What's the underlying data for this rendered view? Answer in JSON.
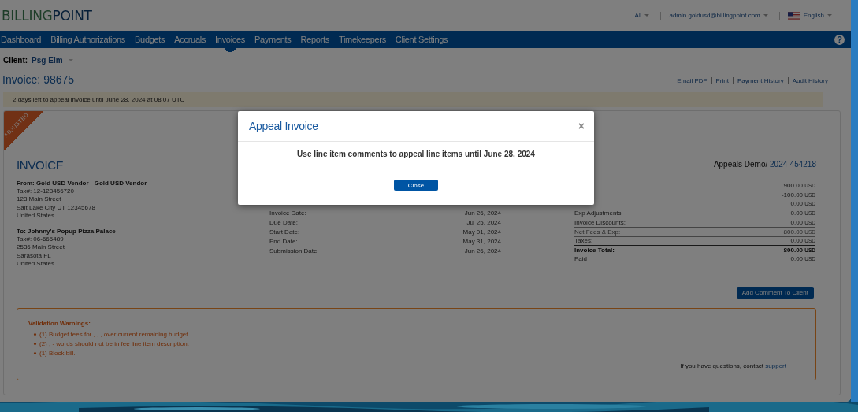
{
  "header": {
    "logo": [
      "BILLING",
      "POINT"
    ],
    "scope": "All",
    "user": "admin.goldusd@billingpoint.com",
    "language": "English"
  },
  "nav": [
    {
      "label": "Dashboard",
      "selected": false
    },
    {
      "label": "Billing Authorizations",
      "selected": false
    },
    {
      "label": "Budgets",
      "selected": false
    },
    {
      "label": "Accruals",
      "selected": false
    },
    {
      "label": "Invoices",
      "selected": true
    },
    {
      "label": "Payments",
      "selected": false
    },
    {
      "label": "Reports",
      "selected": false
    },
    {
      "label": "Timekeepers",
      "selected": false
    },
    {
      "label": "Client Settings",
      "selected": false
    }
  ],
  "help": "?",
  "client": {
    "label": "Client:",
    "name": "Psg Elm"
  },
  "invoice_title": "Invoice: 98675",
  "actions": [
    "Email PDF",
    "Print",
    "Payment History",
    "Audit History"
  ],
  "alert": "2 days left to appeal invoice until June 28, 2024 at 08:07 UTC",
  "invoice": {
    "ribbon": "ADJUSTED",
    "heading": "INVOICE",
    "project": {
      "label": "Appeals Demo/",
      "link": "2024-454218"
    },
    "from": {
      "title": "From: Gold USD Vendor - Gold USD Vendor",
      "lines": [
        "Tax#: 12-123456720",
        "123 Main Street",
        "Salt Lake City UT 12345678",
        "United States"
      ]
    },
    "to": {
      "title": "To: Johnny's Popup Pizza Palace",
      "lines": [
        "Tax#: 06-665489",
        "2536 Main Street",
        "Sarasota FL",
        "United States"
      ]
    },
    "dates": [
      {
        "label": "Invoice Date:",
        "value": "Jun 26, 2024"
      },
      {
        "label": "Due Date:",
        "value": "Jul 25, 2024"
      },
      {
        "label": "Start Date:",
        "value": "May 01, 2024"
      },
      {
        "label": "End Date:",
        "value": "May 31, 2024"
      },
      {
        "label": "Submission Date:",
        "value": "Jun 26, 2024"
      }
    ],
    "totals": [
      {
        "kind": "normal",
        "value": "900.00",
        "currency": "USD"
      },
      {
        "kind": "normal",
        "value": "-100.00",
        "currency": "USD"
      },
      {
        "kind": "normal",
        "value": "0.00",
        "currency": "USD"
      },
      {
        "kind": "normal",
        "label": "Exp Adjustments:",
        "value": "0.00",
        "currency": "USD"
      },
      {
        "kind": "normal",
        "label": "Invoice Discounts:",
        "value": "0.00",
        "currency": "USD"
      },
      {
        "kind": "subtotal",
        "label": "Net Fees & Exp:",
        "value": "800.00",
        "currency": "USD"
      },
      {
        "kind": "tax",
        "label": "Taxes:",
        "value": "0.00",
        "currency": "USD"
      },
      {
        "kind": "total",
        "label": "Invoice Total:",
        "value": "800.00",
        "currency": "USD"
      },
      {
        "kind": "normal",
        "label": "Paid",
        "value": "0.00",
        "currency": "USD"
      }
    ]
  },
  "comment_button": "Add Comment To Client",
  "warnings": {
    "title": "Validation Warnings:",
    "items": [
      "(1) Budget fees for , , , over current remaining budget.",
      "(2) ; - words should not be in fee line item description.",
      "(1) Block bill."
    ]
  },
  "support": {
    "text": "If you have questions, contact",
    "link": "support"
  },
  "modal": {
    "title": "Appeal Invoice",
    "close": "×",
    "message": "Use line item comments to appeal line items until June 28, 2024",
    "button": "Close"
  }
}
